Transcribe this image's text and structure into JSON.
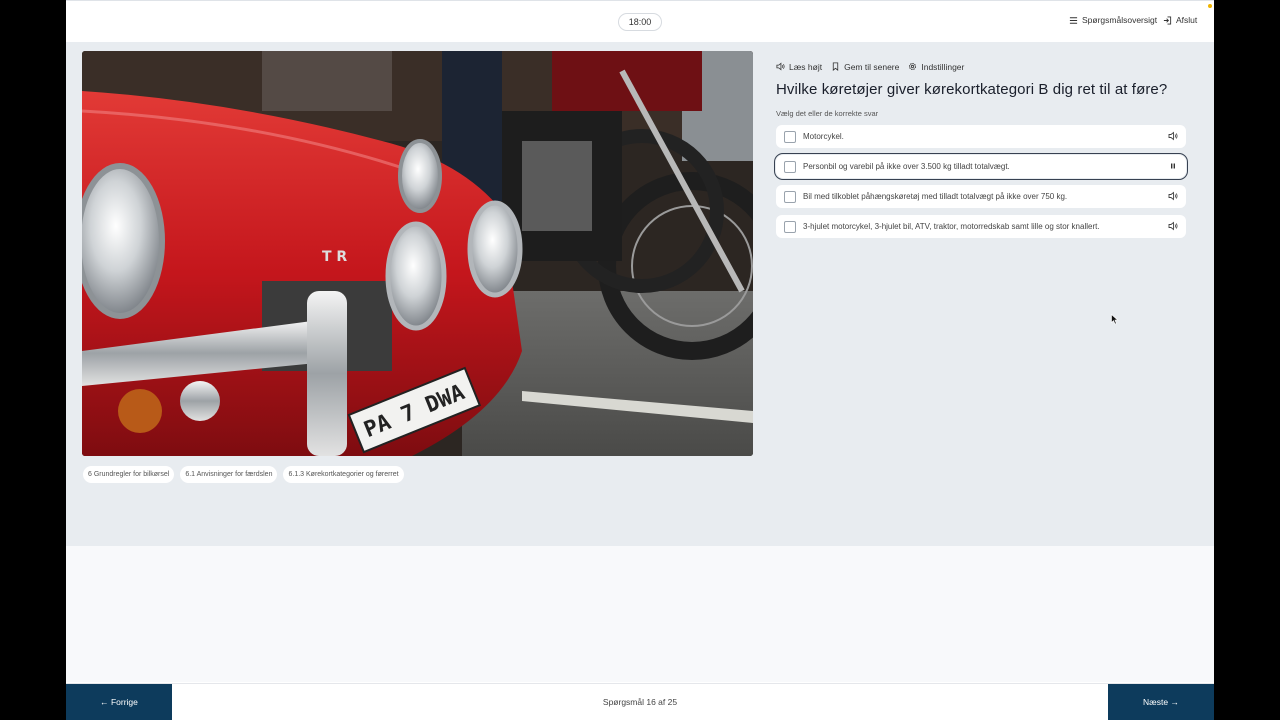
{
  "header": {
    "timer": "18:00",
    "overview_label": "Spørgsmålsoversigt",
    "exit_label": "Afslut"
  },
  "tools": {
    "read_aloud": "Læs højt",
    "save_later": "Gem til senere",
    "settings": "Indstillinger"
  },
  "question": {
    "title": "Hvilke køretøjer giver kørekortkategori B dig ret til at føre?",
    "hint": "Vælg det eller de korrekte svar",
    "options": [
      {
        "label": "Motorcykel.",
        "audio_icon": "speaker-icon"
      },
      {
        "label": "Personbil og varebil på ikke over 3.500 kg tilladt totalvægt.",
        "audio_icon": "pause-icon"
      },
      {
        "label": "Bil med tilkoblet påhængskøretøj med tilladt totalvægt på ikke over 750 kg.",
        "audio_icon": "speaker-icon"
      },
      {
        "label": "3-hjulet motorcykel, 3-hjulet bil, ATV, traktor, motorredskab samt lille og stor knallert.",
        "audio_icon": "speaker-icon"
      }
    ]
  },
  "tags": [
    "6 Grundregler for bilkørsel",
    "6.1 Anvisninger for færdslen",
    "6.1.3 Kørekortkategorier og førerret"
  ],
  "image": {
    "plate_text": "PA 7 DWA",
    "badge_text": "T R"
  },
  "footer": {
    "prev_label": "← Forrige",
    "next_label": "Næste →",
    "progress": "Spørgsmål 16 af 25"
  },
  "colors": {
    "nav_button": "#0d3b5c",
    "content_bg": "#e8ecf0",
    "car_red": "#c4161c"
  }
}
